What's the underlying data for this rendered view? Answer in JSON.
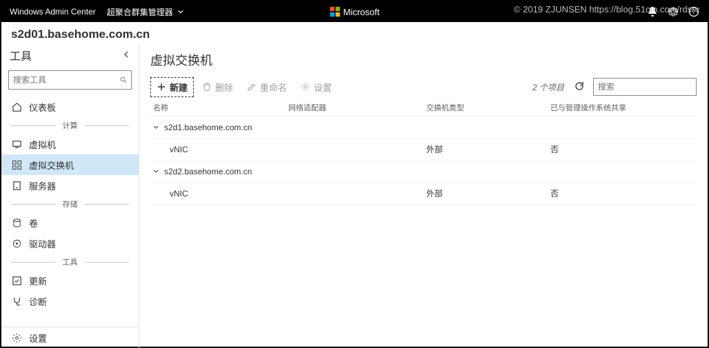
{
  "watermark": "© 2019 ZJUNSEN https://blog.51cto.com/rdsrv",
  "topbar": {
    "product": "Windows Admin Center",
    "manager": "超聚合群集管理器",
    "brand": "Microsoft"
  },
  "cluster": {
    "title": "s2d01.basehome.com.cn"
  },
  "sidebar": {
    "title": "工具",
    "search_placeholder": "搜索工具",
    "groups": {
      "compute": "计算",
      "storage": "存储",
      "tools": "工具"
    },
    "items": {
      "dashboard": "仪表板",
      "vm": "虚拟机",
      "vswitch": "虚拟交换机",
      "server": "服务器",
      "volume": "卷",
      "drive": "驱动器",
      "update": "更新",
      "diagnose": "诊断",
      "settings": "设置"
    }
  },
  "main": {
    "title": "虚拟交换机",
    "toolbar": {
      "new": "新建",
      "delete": "删除",
      "rename": "重命名",
      "settings": "设置",
      "item_count": "2 个项目",
      "search_placeholder": "搜索"
    },
    "columns": {
      "name": "名称",
      "adapter": "网络适配器",
      "type": "交换机类型",
      "shared": "已与管理操作系统共享"
    },
    "groups": [
      {
        "host": "s2d1.basehome.com.cn",
        "rows": [
          {
            "name": "vNIC",
            "adapter": "",
            "type": "外部",
            "shared": "否"
          }
        ]
      },
      {
        "host": "s2d2.basehome.com.cn",
        "rows": [
          {
            "name": "vNIC",
            "adapter": "",
            "type": "外部",
            "shared": "否"
          }
        ]
      }
    ]
  }
}
